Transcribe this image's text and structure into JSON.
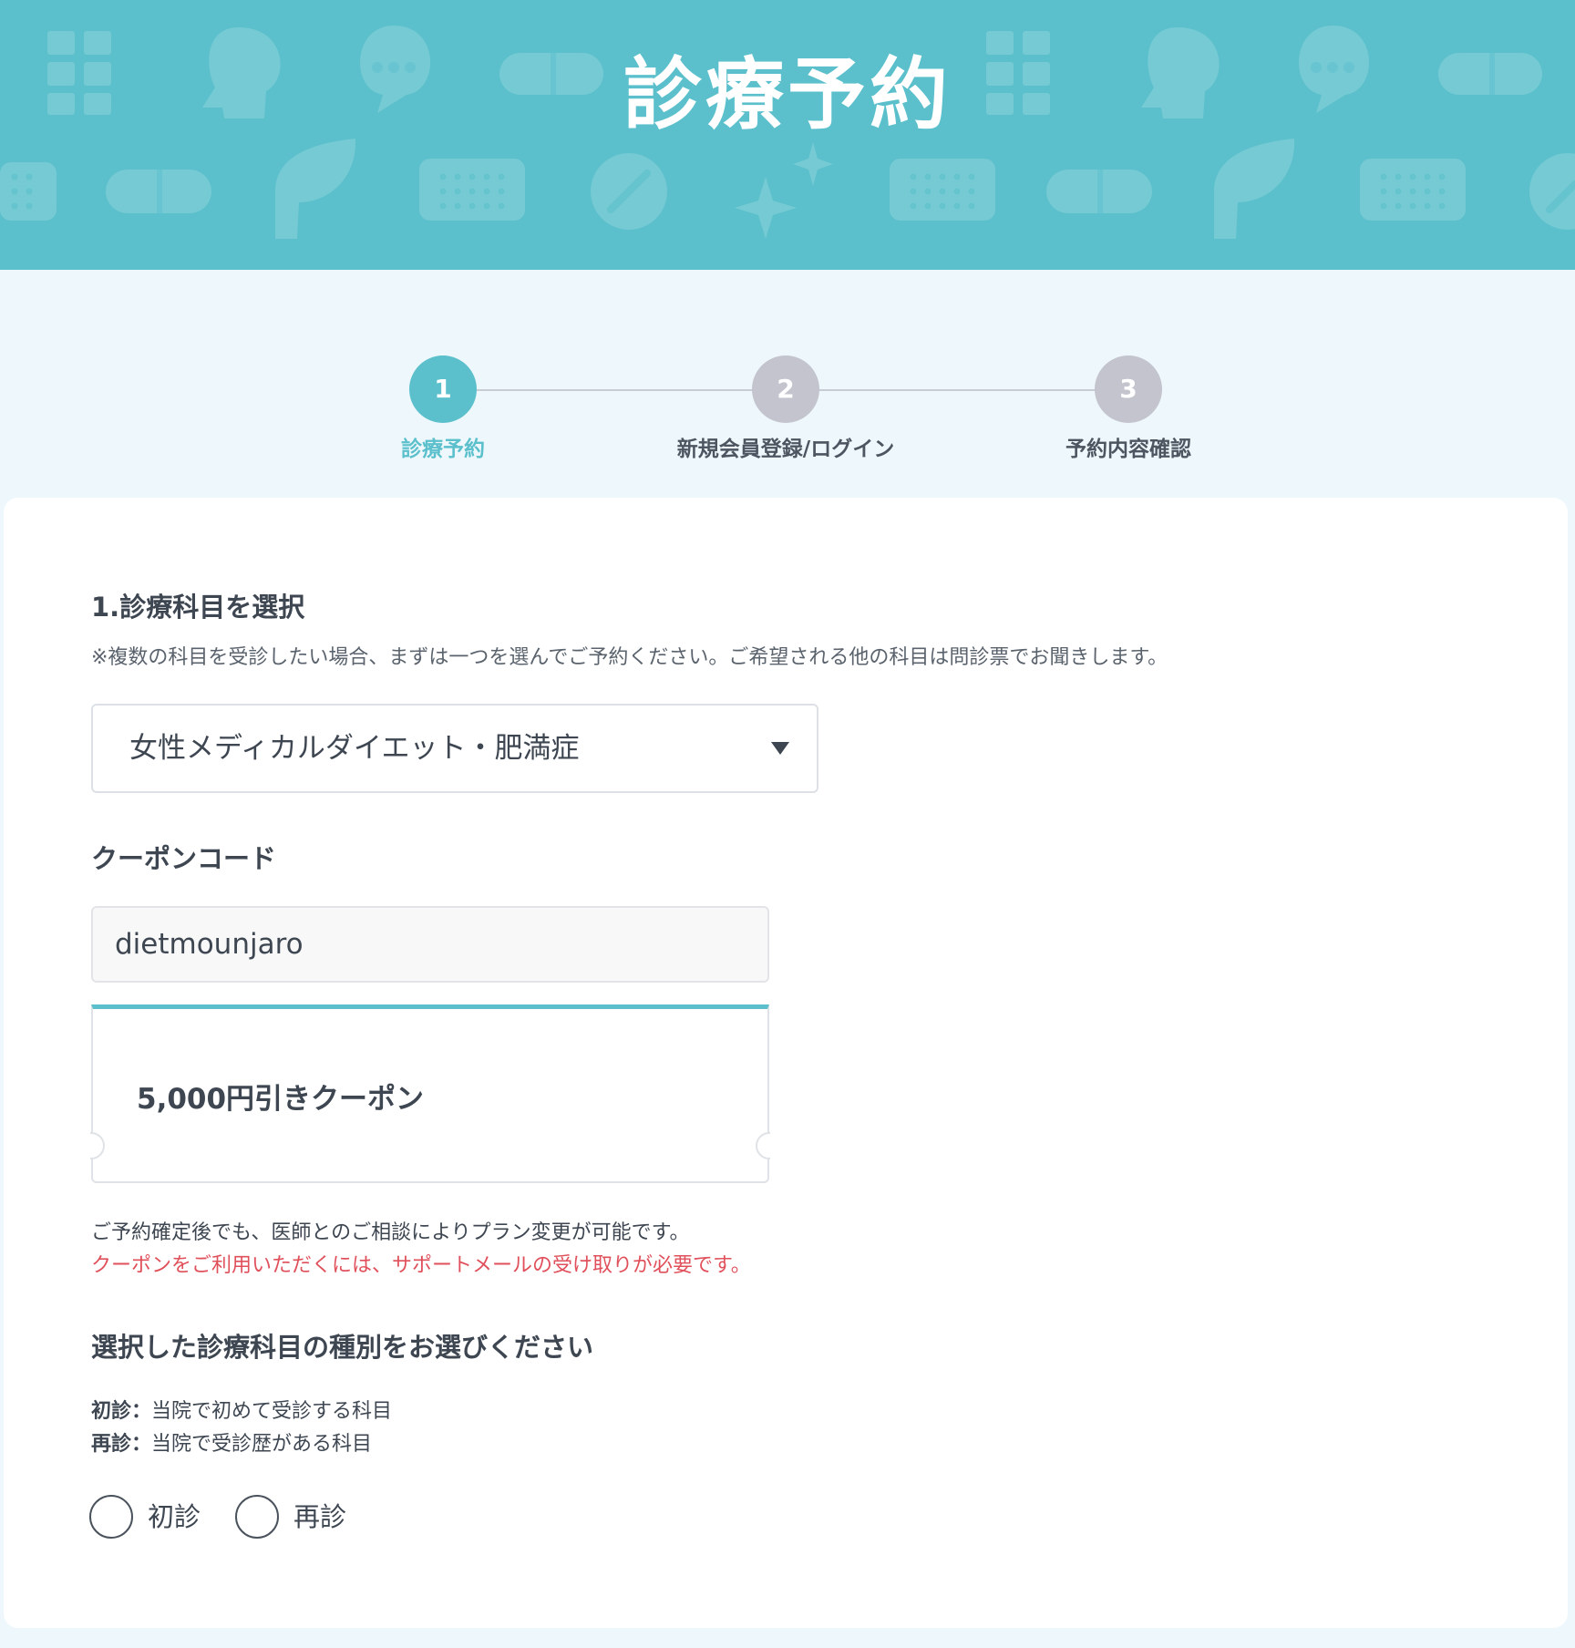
{
  "header": {
    "title": "診療予約",
    "background_color": "#5bc0cc"
  },
  "stepper": {
    "steps": [
      {
        "number": "1",
        "label": "診療予約",
        "state": "active"
      },
      {
        "number": "2",
        "label": "新規会員登録/ログイン",
        "state": "inactive"
      },
      {
        "number": "3",
        "label": "予約内容確認",
        "state": "inactive"
      }
    ]
  },
  "department": {
    "title": "1.診療科目を選択",
    "note": "※複数の科目を受診したい場合、まずは一つを選んでご予約ください。ご希望される他の科目は問診票でお聞きします。",
    "selected_value": "女性メディカルダイエット・肥満症"
  },
  "coupon": {
    "title": "クーポンコード",
    "input_value": "dietmounjaro",
    "applied_coupon_name": "5,000円引きクーポン",
    "info_text": "ご予約確定後でも、医師とのご相談によりプラン変更が可能です。",
    "warning_text": "クーポンをご利用いただくには、サポートメールの受け取りが必要です。"
  },
  "visit_type": {
    "title": "選択した診療科目の種別をお選びください",
    "definitions": [
      {
        "term": "初診",
        "separator": "：",
        "description": "当院で初めて受診する科目"
      },
      {
        "term": "再診",
        "separator": "：",
        "description": "当院で受診歴がある科目"
      }
    ],
    "options": [
      {
        "label": "初診",
        "selected": false
      },
      {
        "label": "再診",
        "selected": false
      }
    ]
  },
  "colors": {
    "accent": "#5bc0cc",
    "warning": "#e0505b",
    "inactive_step": "#c3c4cd",
    "page_background": "#eef8fc"
  }
}
